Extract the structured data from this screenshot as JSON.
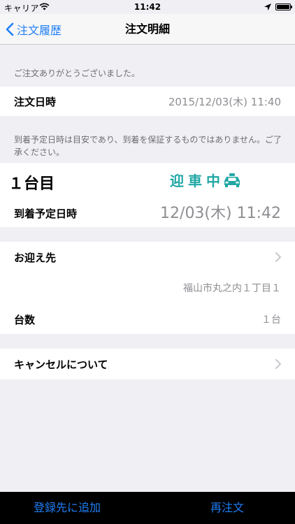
{
  "status_bar": {
    "carrier": "キャリア",
    "time": "11:42"
  },
  "nav": {
    "back_label": "注文履歴",
    "title": "注文明細"
  },
  "thanks_note": "ご注文ありがとうございました。",
  "order_datetime": {
    "label": "注文日時",
    "value": "2015/12/03(木) 11:40"
  },
  "arrival_note": "到着予定日時は目安であり、到着を保証するものではありません。ご了承ください。",
  "car": {
    "number": "１台目",
    "status": "迎車中",
    "arrival_label": "到着予定日時",
    "arrival_value": "12/03(木) 11:42"
  },
  "pickup": {
    "label": "お迎え先",
    "address": "福山市丸之内１丁目１"
  },
  "count": {
    "label": "台数",
    "value": "１台"
  },
  "cancel": {
    "label": "キャンセルについて"
  },
  "toolbar": {
    "add_label": "登録先に追加",
    "reorder_label": "再注文"
  },
  "colors": {
    "accent": "#1f7ef5",
    "status_teal": "#21a7a4",
    "background": "#efeff4"
  },
  "icons": [
    "wifi-icon",
    "location-icon",
    "battery-icon",
    "back-chevron-icon",
    "taxi-icon",
    "chevron-right-icon"
  ]
}
